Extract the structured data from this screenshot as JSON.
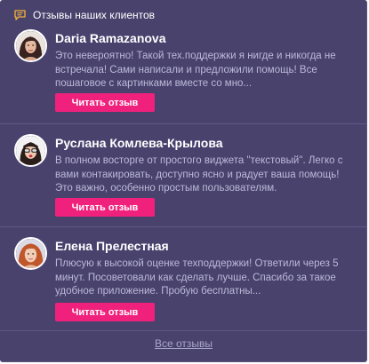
{
  "header": {
    "title": "Отзывы наших клиентов"
  },
  "reviews": [
    {
      "name": "Daria Ramazanova",
      "text": "Это невероятно! Такой тех.поддержки я нигде и никогда не встречала! Сами написали и предложили помощь! Все пошаговое с картинками вместе со мно...",
      "button": "Читать отзыв"
    },
    {
      "name": "Руслана Комлева-Крылова",
      "text": "В полном восторге от простого виджета \"текстовый\". Легко с вами контакировать, доступно ясно и радует ваша помощь! Это важно, особенно простым пользователям.",
      "button": "Читать отзыв"
    },
    {
      "name": "Елена Прелестная",
      "text": "Плюсую к высокой оценке техподдержки! Ответили через 5 минут. Посоветовали как сделать лучше. Спасибо за такое удобное приложение. Пробую бесплатны...",
      "button": "Читать отзыв"
    }
  ],
  "footer": {
    "all_reviews": "Все отзывы"
  },
  "colors": {
    "background": "#48426d",
    "accent": "#f0217d",
    "text_muted": "#bdb9d8",
    "link": "#a9a5c8",
    "header_icon": "#f5b335"
  }
}
